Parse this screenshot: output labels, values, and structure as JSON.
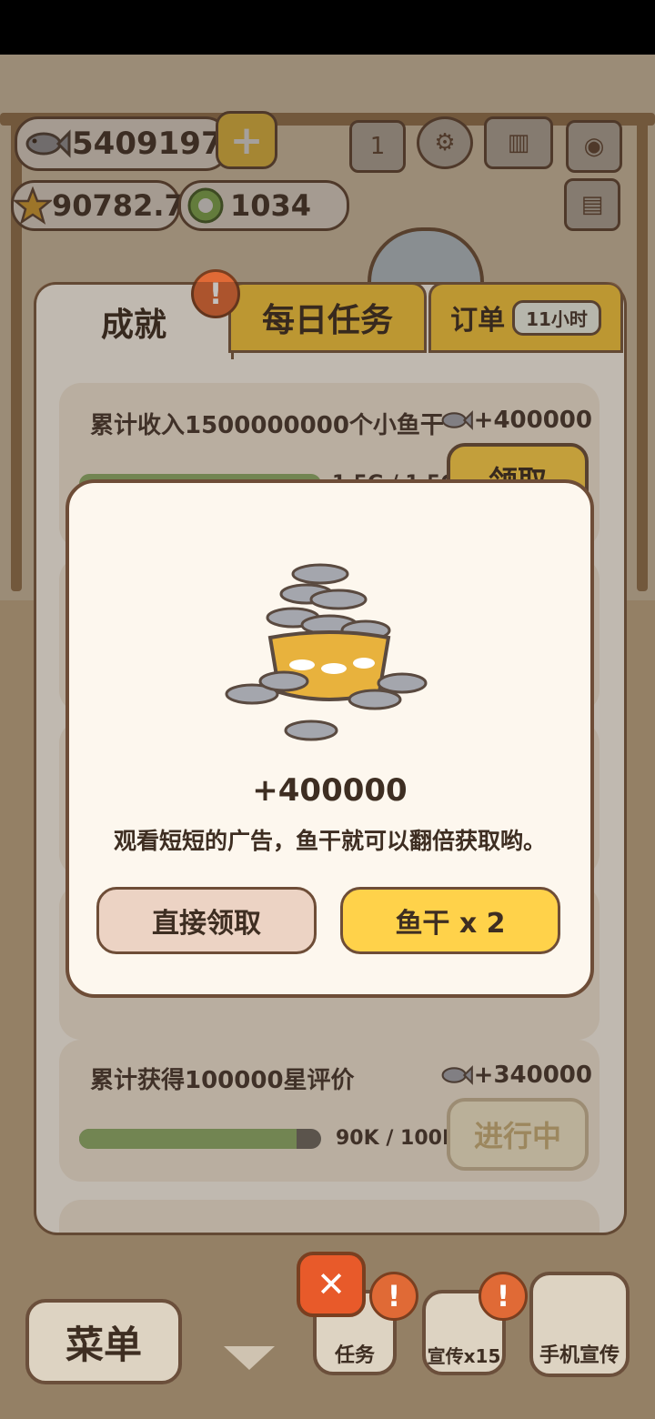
{
  "currency": {
    "fish": "5409197",
    "stars": "90782.7",
    "gems": "1034"
  },
  "top_icons": {
    "ranking": "1"
  },
  "tabs": {
    "achievements": "成就",
    "daily": "每日任务",
    "orders": "订单",
    "orders_timer": "11小时",
    "alert": "!"
  },
  "cards": [
    {
      "title": "累计收入1500000000个小鱼干",
      "reward": "+400000",
      "progress_text": "1.5G / 1.5G",
      "progress": 1.0,
      "button": "领取"
    },
    {
      "title": "累计获得100000星评价",
      "reward": "+340000",
      "progress_text": "90K  / 100K",
      "progress": 0.9,
      "button": "进行中"
    }
  ],
  "modal": {
    "amount": "+400000",
    "description": "观看短短的广告，鱼干就可以翻倍获取哟。",
    "collect_button": "直接领取",
    "double_button": "鱼干 x 2"
  },
  "bottom": {
    "menu": "菜单",
    "tasks": "任务",
    "promo": "宣传x15",
    "phone_promo": "手机宣传",
    "close": "✕"
  },
  "colors": {
    "panel_bg": "#fbf5ec",
    "tab_yellow": "#f6c63d",
    "button_yellow": "#ffd24a",
    "button_pink": "#ecd3c4",
    "progress_green": "#8fae6a",
    "alert_orange": "#e06a36"
  }
}
